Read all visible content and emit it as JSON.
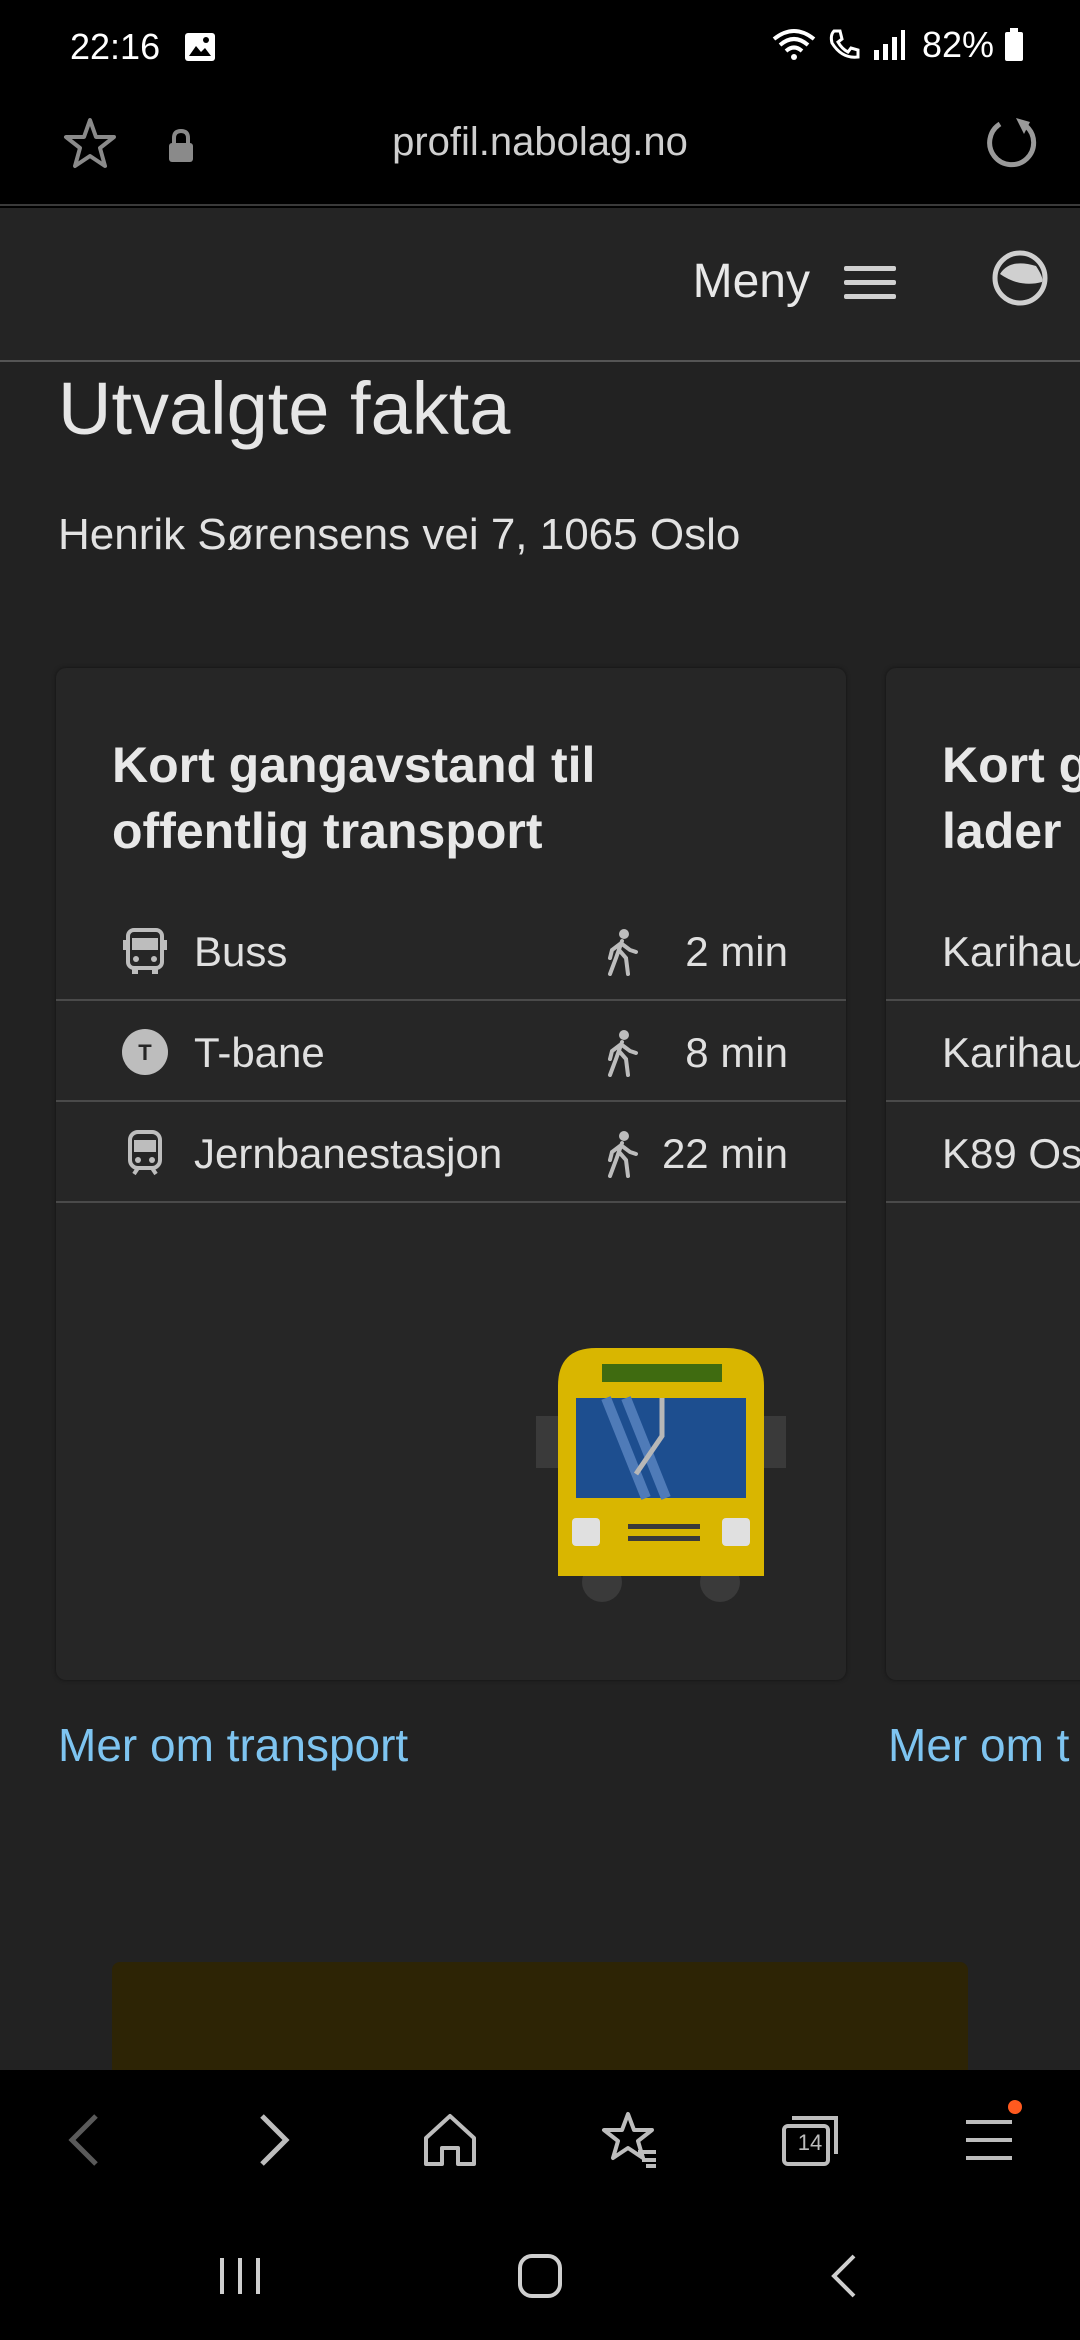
{
  "status": {
    "time": "22:16",
    "battery": "82%"
  },
  "browser": {
    "url": "profil.nabolag.no",
    "tab_count": "14"
  },
  "header": {
    "menu_label": "Meny"
  },
  "main": {
    "title": "Utvalgte fakta",
    "address": "Henrik Sørensens vei 7, 1065 Oslo"
  },
  "card1": {
    "title_line1": "Kort gangavstand til",
    "title_line2": "offentlig transport",
    "rows": [
      {
        "label": "Buss",
        "time": "2 min",
        "icon": "bus-icon"
      },
      {
        "label": "T-bane",
        "time": "8 min",
        "icon": "metro-icon"
      },
      {
        "label": "Jernbanestasjon",
        "time": "22 min",
        "icon": "train-icon"
      }
    ],
    "link": "Mer om transport"
  },
  "card2": {
    "title_line1": "Kort g",
    "title_line2": "lader",
    "rows": [
      {
        "label": "Karihau"
      },
      {
        "label": "Karihau"
      },
      {
        "label": "K89 Os"
      }
    ],
    "link": "Mer om t"
  },
  "colors": {
    "link": "#7ec4f0",
    "bus_yellow": "#d9b600",
    "bus_window": "#1d4e8f",
    "notification": "#ff5a1f"
  }
}
